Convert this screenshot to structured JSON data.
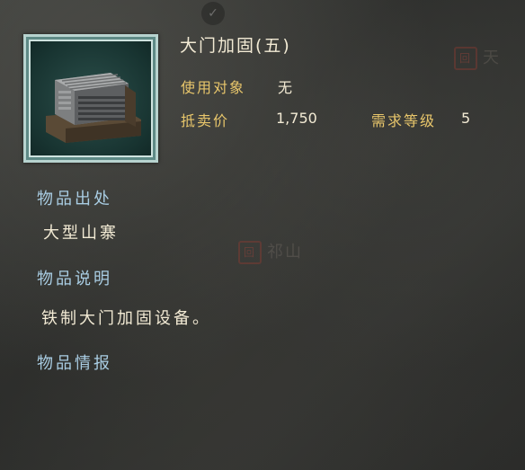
{
  "item": {
    "name": "大门加固(五)",
    "icon": "gate-reinforcement-icon",
    "target_label": "使用对象",
    "target_value": "无",
    "price_label": "抵卖价",
    "price_value": "1,750",
    "level_label": "需求等级",
    "level_value": "5"
  },
  "sections": {
    "source_heading": "物品出处",
    "source_text": "大型山寨",
    "description_heading": "物品说明",
    "description_text": "铁制大门加固设备。",
    "info_heading": "物品情报"
  },
  "background": {
    "map_label_1": "天",
    "map_label_2": "祁山",
    "seal_char": "回"
  },
  "colors": {
    "label_gold": "#e8c66b",
    "value_cream": "#f2ead4",
    "heading_blue": "#a9cde3",
    "frame_teal": "#b7d3cf"
  }
}
